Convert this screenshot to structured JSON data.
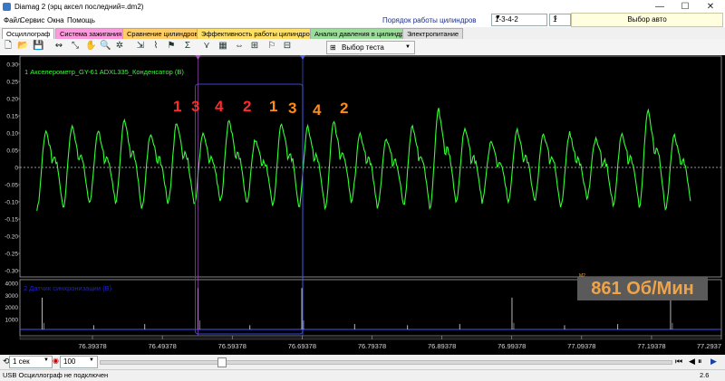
{
  "window": {
    "title": "Diamag 2 (эрц аксел последний=.dm2)",
    "minimize": "—",
    "maximize": "☐",
    "close": "✕"
  },
  "menu": {
    "items": [
      "Файл",
      "Сервис",
      "Окна",
      "Помощь"
    ],
    "cylinder_order_label": "Порядок работы цилиндров",
    "cylinder_order_value": "1-3-4-2",
    "cylinder_number_value": "1",
    "auto_select_button": "Выбор авто"
  },
  "tabs": [
    {
      "label": "Осциллограф",
      "color": "#ffffff"
    },
    {
      "label": "Система зажигания",
      "color": "#ff99dd"
    },
    {
      "label": "Сравнение цилиндров",
      "color": "#ffcc66"
    },
    {
      "label": "Эффективность работы цилиндров",
      "color": "#ffe066"
    },
    {
      "label": "Анализ давления в цилиндре",
      "color": "#99dd99"
    },
    {
      "label": "Электропитание",
      "color": "#dddddd"
    }
  ],
  "toolbar": {
    "test_select_label": "Выбор теста"
  },
  "colors": {
    "main_trace": "#33ff33",
    "sync_trace": "#cccccc",
    "sync_channel_text": "#2222cc",
    "order_red": "#ff2a2a",
    "order_orange": "#ff8c1a",
    "cursor_box": "#3346d6",
    "rpm_text": "#f0a44a"
  },
  "chart_data": {
    "type": "line",
    "series": [
      {
        "name": "1 Акселерометр_GY-61 ADXL335_Конденсатор (В)",
        "axis": "top",
        "ylim": [
          -0.3,
          0.3
        ],
        "tick_labels": [
          "0.30",
          "0.25",
          "0.20",
          "0.15",
          "0.10",
          "0.05",
          "0",
          "-0.05",
          "-0.10",
          "-0.15",
          "-0.20",
          "-0.25",
          "-0.30"
        ],
        "peaks": [
          0.105,
          0.12,
          0.11,
          0.14,
          0.1,
          0.13,
          0.1,
          0.14,
          0.08,
          0.13,
          0.12,
          0.135,
          0.095,
          0.085,
          0.12,
          0.17,
          0.115,
          0.075,
          0.11,
          0.1,
          0.1,
          0.085,
          0.1,
          0.17,
          0.09
        ],
        "troughs": [
          -0.12,
          -0.115,
          -0.105,
          -0.1,
          -0.12,
          -0.105,
          -0.11,
          -0.1,
          -0.105,
          -0.11,
          -0.115,
          -0.12,
          -0.1,
          -0.12,
          -0.11,
          -0.12,
          -0.105,
          -0.1,
          -0.1,
          -0.1,
          -0.115,
          -0.09,
          -0.11,
          -0.115,
          -0.12
        ]
      },
      {
        "name": "2 Датчик синхронизации (В)",
        "axis": "bottom",
        "ylim": [
          0,
          4000
        ],
        "tick_labels": [
          "4000",
          "3000",
          "2000",
          "1000"
        ],
        "spike_times": [
          76.3217,
          76.3955,
          76.4686,
          76.5448,
          76.619,
          76.6933,
          76.7689,
          76.8446,
          76.9193,
          76.9941,
          77.0693,
          77.1454,
          77.221
        ],
        "spike_values": [
          2800,
          500,
          600,
          3600,
          500,
          3600,
          600,
          500,
          600,
          2800,
          500,
          600,
          2800
        ]
      }
    ],
    "x_tick_labels": [
      "76.39378",
      "76.49378",
      "76.59378",
      "76.69378",
      "76.79378",
      "76.89378",
      "76.99378",
      "77.09378",
      "77.19378",
      "77.2937"
    ],
    "xlim": [
      76.29,
      77.2937
    ]
  },
  "annotations": {
    "firing_order_red": [
      "1",
      "3",
      "4",
      "2"
    ],
    "firing_order_orange": [
      "1",
      "3",
      "4",
      "2"
    ],
    "rpm": "861 Об/Мин",
    "rpm_tag": "M2"
  },
  "bottom": {
    "timebase": "1 сек",
    "zoom": "100",
    "right_value": "2.6"
  },
  "status": {
    "text": "USB Осциллограф не подключен"
  }
}
